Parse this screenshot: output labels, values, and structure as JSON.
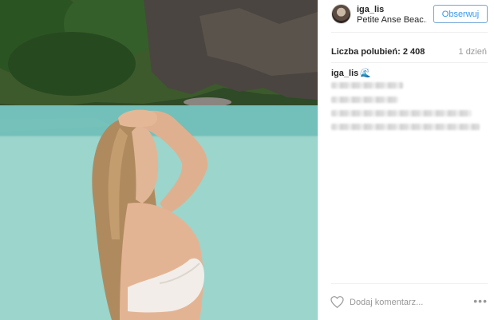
{
  "post": {
    "username": "iga_lis",
    "location": "Petite Anse Beac...",
    "follow_label": "Obserwuj",
    "likes_label": "Liczba polubień: 2 408",
    "time_label": "1 dzień",
    "caption_username": "iga_lis",
    "caption_emoji": "🌊",
    "comment_placeholder": "Dodaj komentarz...",
    "more_label": "•••"
  },
  "colors": {
    "follow_text": "#3897f0",
    "follow_border": "#70a6d6",
    "muted_text": "#999999",
    "primary_text": "#262626",
    "divider": "#efefef"
  },
  "icons": [
    "heart-icon",
    "more-options-icon",
    "avatar"
  ]
}
